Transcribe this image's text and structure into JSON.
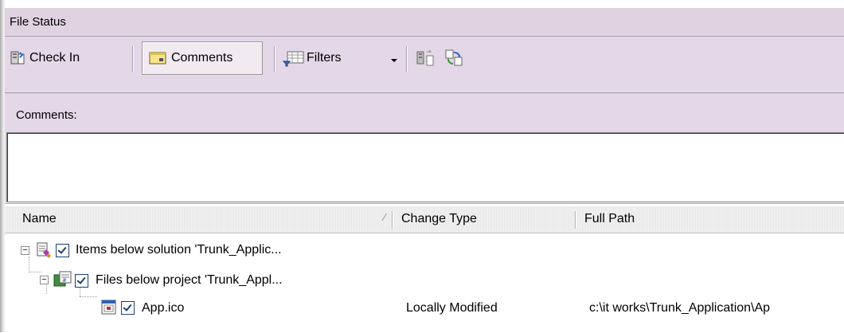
{
  "panel": {
    "title": "File Status"
  },
  "toolbar": {
    "check_in_label": "Check In",
    "comments_label": "Comments",
    "filters_label": "Filters"
  },
  "comments": {
    "label": "Comments:",
    "value": ""
  },
  "columns": {
    "name": "Name",
    "change_type": "Change Type",
    "full_path": "Full Path"
  },
  "rows": [
    {
      "name": "Items below solution 'Trunk_Applic...",
      "change_type": "",
      "full_path": ""
    },
    {
      "name": "Files below project 'Trunk_Appl...",
      "change_type": "",
      "full_path": ""
    },
    {
      "name": "App.ico",
      "change_type": "Locally Modified",
      "full_path": "c:\\it works\\Trunk_Application\\Ap"
    }
  ],
  "colors": {
    "toolbar_bg": "#e4d7e7",
    "title_bg": "#e1d2e2",
    "checkbox": "#1f3f74"
  }
}
